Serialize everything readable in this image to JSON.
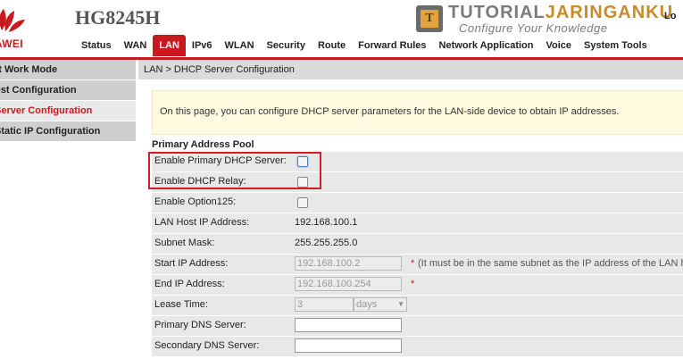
{
  "header": {
    "brand": "AWEI",
    "model": "HG8245H",
    "logout": "Lo",
    "nav": [
      "Status",
      "WAN",
      "LAN",
      "IPv6",
      "WLAN",
      "Security",
      "Route",
      "Forward Rules",
      "Network Application",
      "Voice",
      "System Tools"
    ],
    "active_nav": "LAN",
    "accent_color": "#c8191e"
  },
  "watermark": {
    "letter": "T",
    "title_part1": "TUTORIAL",
    "title_part2": "JARINGANKU",
    "tagline": "Configure Your Knowledge"
  },
  "sidebar": {
    "items": [
      {
        "label": "rt Work Mode"
      },
      {
        "label": "ost Configuration"
      },
      {
        "label": "Server Configuration"
      },
      {
        "label": "Static IP Configuration"
      }
    ],
    "active_index": 2
  },
  "main": {
    "breadcrumb": "LAN > DHCP Server Configuration",
    "info": "On this page, you can configure DHCP server parameters for the LAN-side device to obtain IP addresses.",
    "section_title": "Primary Address Pool",
    "rows": {
      "enable_primary_dhcp": "Enable Primary DHCP Server:",
      "enable_dhcp_relay": "Enable DHCP Relay:",
      "enable_option125": "Enable Option125:",
      "lan_host_ip_label": "LAN Host IP Address:",
      "lan_host_ip_value": "192.168.100.1",
      "subnet_mask_label": "Subnet Mask:",
      "subnet_mask_value": "255.255.255.0",
      "start_ip_label": "Start IP Address:",
      "start_ip_value": "192.168.100.2",
      "start_ip_note": "(It must be in the same subnet as the IP address of the LAN ho",
      "end_ip_label": "End IP Address:",
      "end_ip_value": "192.168.100.254",
      "lease_time_label": "Lease Time:",
      "lease_time_value": "3",
      "lease_unit": "days",
      "primary_dns_label": "Primary DNS Server:",
      "primary_dns_value": "",
      "secondary_dns_label": "Secondary DNS Server:",
      "secondary_dns_value": "",
      "required_mark": "*"
    }
  }
}
